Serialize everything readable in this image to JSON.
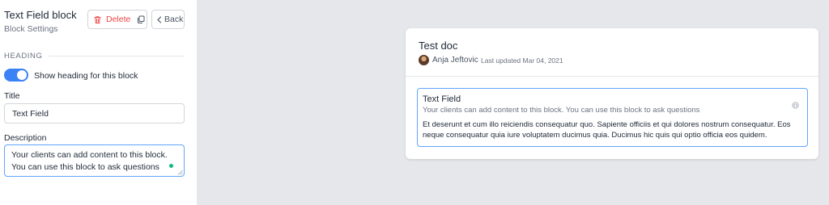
{
  "sidebar": {
    "title": "Text Field block",
    "subtitle": "Block Settings",
    "delete_label": "Delete",
    "back_label": "Back",
    "section_heading": "HEADING",
    "toggle_label": "Show heading for this block",
    "toggle_on": true,
    "title_field": {
      "label": "Title",
      "value": "Text Field"
    },
    "description_field": {
      "label": "Description",
      "value": "Your clients can add content to this block. You can use this block to ask questions"
    }
  },
  "document": {
    "title": "Test doc",
    "author": "Anja Jeftovic",
    "last_updated": "Last updated Mar 04, 2021",
    "block": {
      "title": "Text Field",
      "description": "Your clients can add content to this block. You can use this block to ask questions",
      "body": "Et deserunt et cum illo reiciendis consequatur quo. Sapiente officiis et qui dolores nostrum consequatur. Eos neque consequatur quia iure voluptatem ducimus quia. Ducimus hic quis qui optio officia eos quidem."
    }
  },
  "colors": {
    "accent": "#3b82f6",
    "delete": "#ef4444",
    "canvas": "#e5e7eb",
    "status_dot": "#10b981"
  },
  "icons": [
    "trash-icon",
    "copy-icon",
    "chevron-left-icon",
    "info-icon",
    "avatar",
    "resize-handle-icon"
  ]
}
